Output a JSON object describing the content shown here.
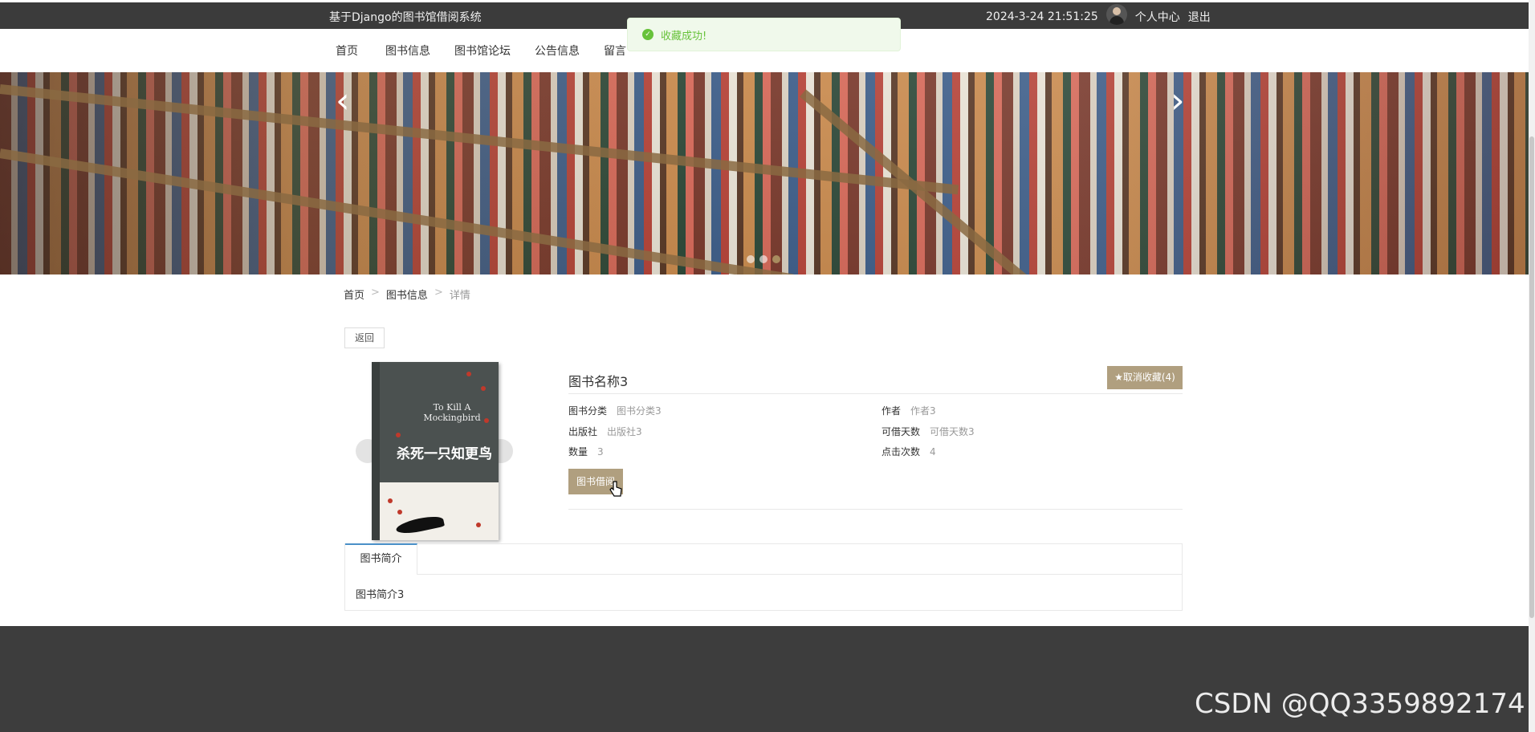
{
  "header": {
    "site_title": "基于Django的图书馆借阅系统",
    "datetime": "2024-3-24 21:51:25",
    "profile_label": "个人中心",
    "logout_label": "退出"
  },
  "nav": {
    "items": [
      {
        "label": "首页"
      },
      {
        "label": "图书信息"
      },
      {
        "label": "图书馆论坛"
      },
      {
        "label": "公告信息"
      },
      {
        "label": "留言"
      }
    ]
  },
  "toast": {
    "message": "收藏成功!",
    "icon": "check-icon",
    "color": "#67c23a"
  },
  "banner": {
    "prev_icon": "chevron-left-icon",
    "next_icon": "chevron-right-icon",
    "prev_glyph": "‹",
    "next_glyph": "›"
  },
  "breadcrumb": {
    "home": "首页",
    "section": "图书信息",
    "current": "详情",
    "separator": ">"
  },
  "back_label": "返回",
  "cover": {
    "en_title": "To Kill A Mockingbird",
    "cn_title": "杀死一只知更鸟"
  },
  "book": {
    "name": "图书名称3",
    "fav_label": "★取消收藏(4)",
    "fields": {
      "category_label": "图书分类",
      "category_value": "图书分类3",
      "author_label": "作者",
      "author_value": "作者3",
      "publisher_label": "出版社",
      "publisher_value": "出版社3",
      "days_label": "可借天数",
      "days_value": "可借天数3",
      "count_label": "数量",
      "count_value": "3",
      "clicks_label": "点击次数",
      "clicks_value": "4"
    },
    "borrow_label": "图书借阅"
  },
  "tabs": {
    "intro_tab": "图书简介",
    "intro_content": "图书简介3"
  },
  "watermark": "CSDN @QQ3359892174",
  "colors": {
    "accent": "#b09f7f",
    "topbar": "#3b3b3b",
    "footer": "#3d3d3d",
    "tab_accent": "#4a90c8"
  }
}
